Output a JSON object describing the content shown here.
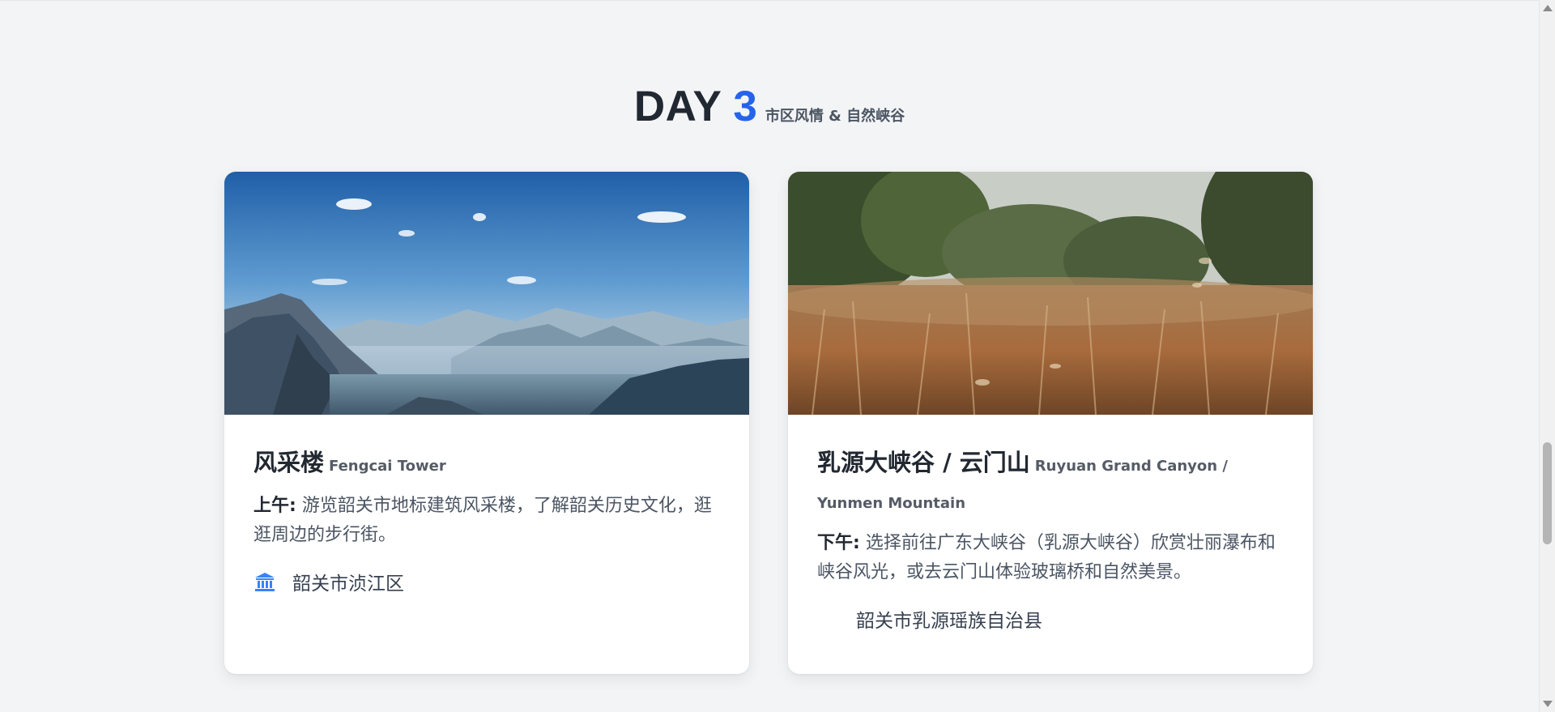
{
  "day": {
    "word": "DAY",
    "number": "3",
    "subtitle": "市区风情 & 自然峡谷"
  },
  "cards": [
    {
      "title_zh": "风采楼",
      "title_en": "Fengcai Tower",
      "time_label": "上午:",
      "description": "游览韶关市地标建筑风采楼，了解韶关历史文化，逛逛周边的步行街。",
      "location": "韶关市浈江区",
      "location_icon": "landmark-icon",
      "image": "mountain-valley-photo"
    },
    {
      "title_zh": "乳源大峡谷 / 云门山",
      "title_en": "Ruyuan Grand Canyon / Yunmen Mountain",
      "time_label": "下午:",
      "description": "选择前往广东大峡谷（乳源大峡谷）欣赏壮丽瀑布和峡谷风光，或去云门山体验玻璃桥和自然美景。",
      "location": "韶关市乳源瑶族自治县",
      "location_icon": "",
      "image": "dry-grass-field-photo"
    }
  ],
  "colors": {
    "accent": "#2563eb",
    "heading": "#222831",
    "background": "#f3f4f6"
  }
}
